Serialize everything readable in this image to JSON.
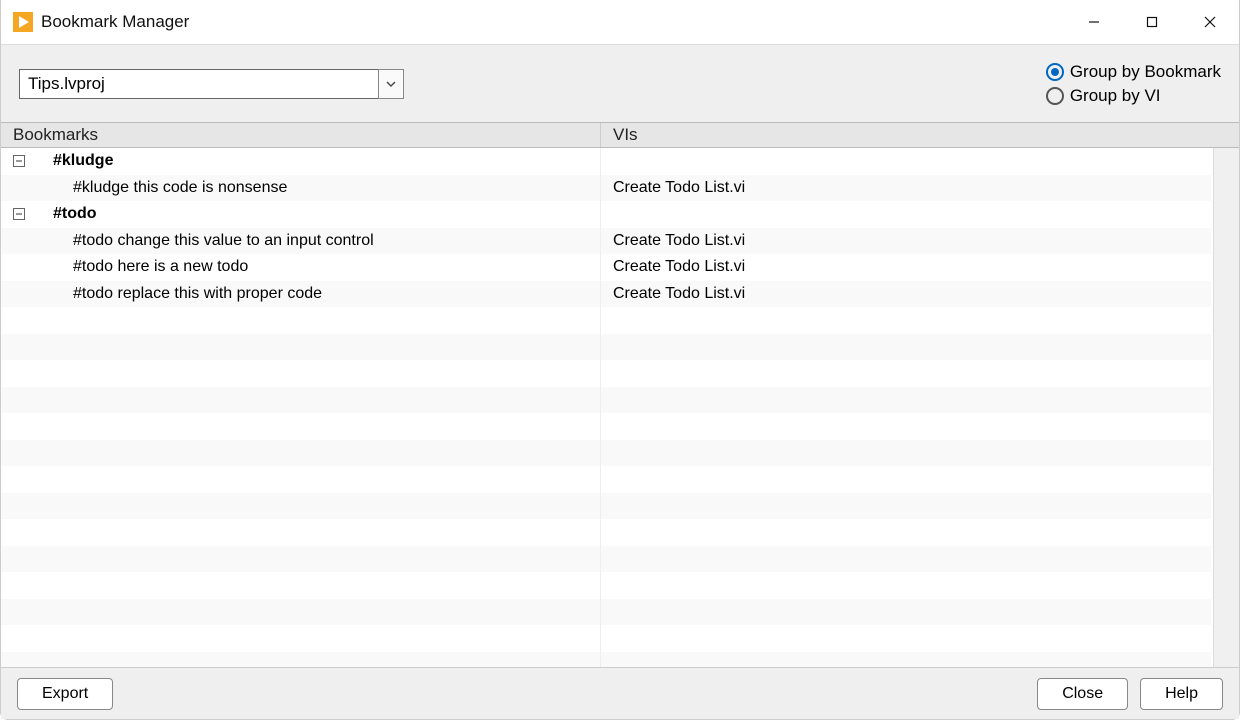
{
  "window": {
    "title": "Bookmark Manager"
  },
  "toolbar": {
    "project_name": "Tips.lvproj",
    "group_by_bookmark_label": "Group by Bookmark",
    "group_by_vi_label": "Group by VI",
    "group_by_bookmark_checked": true,
    "group_by_vi_checked": false
  },
  "columns": {
    "bookmarks_header": "Bookmarks",
    "vis_header": "VIs"
  },
  "tree": [
    {
      "tag": "#kludge",
      "expanded": true,
      "items": [
        {
          "text": "#kludge this code is nonsense",
          "vi": "Create Todo List.vi"
        }
      ]
    },
    {
      "tag": "#todo",
      "expanded": true,
      "items": [
        {
          "text": "#todo change this value to an input control",
          "vi": "Create Todo List.vi"
        },
        {
          "text": "#todo here is a new todo",
          "vi": "Create Todo List.vi"
        },
        {
          "text": "#todo replace this with proper code",
          "vi": "Create Todo List.vi"
        }
      ]
    }
  ],
  "footer": {
    "export_label": "Export",
    "close_label": "Close",
    "help_label": "Help"
  }
}
